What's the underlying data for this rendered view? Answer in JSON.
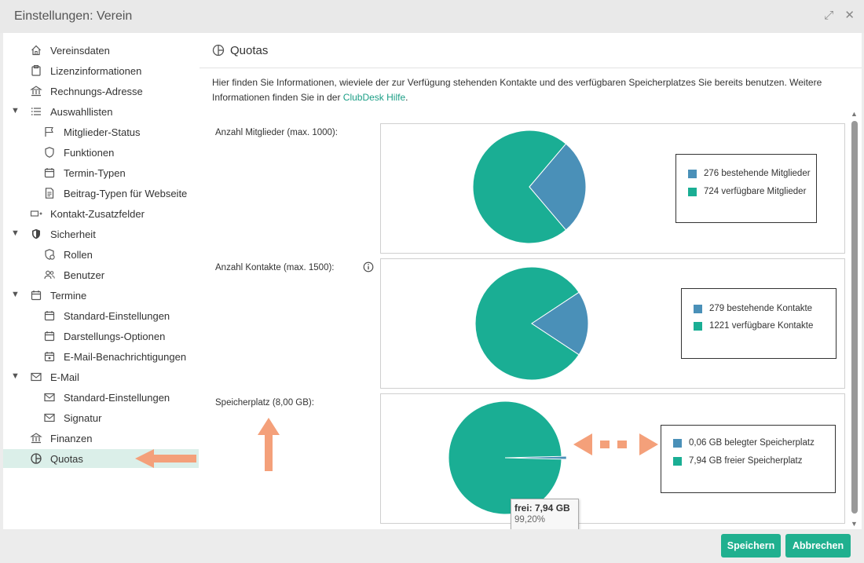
{
  "window": {
    "title": "Einstellungen: Verein",
    "expand_symbol": "⤢",
    "close_symbol": "✕"
  },
  "sidebar": {
    "items": [
      {
        "id": "vereinsdaten",
        "label": "Vereinsdaten",
        "icon": "home-icon",
        "level": 0
      },
      {
        "id": "lizenzinformationen",
        "label": "Lizenzinformationen",
        "icon": "clipboard-icon",
        "level": 0
      },
      {
        "id": "rechnungs-adresse",
        "label": "Rechnungs-Adresse",
        "icon": "bank-icon",
        "level": 0
      },
      {
        "id": "auswahllisten",
        "label": "Auswahllisten",
        "icon": "list-icon",
        "level": 0,
        "expanded": true
      },
      {
        "id": "mitglieder-status",
        "label": "Mitglieder-Status",
        "icon": "flag-icon",
        "level": 1
      },
      {
        "id": "funktionen",
        "label": "Funktionen",
        "icon": "shield-outline-icon",
        "level": 1
      },
      {
        "id": "termin-typen",
        "label": "Termin-Typen",
        "icon": "calendar-icon",
        "level": 1
      },
      {
        "id": "beitrag-typen",
        "label": "Beitrag-Typen für Webseite",
        "icon": "document-icon",
        "level": 1
      },
      {
        "id": "kontakt-zusatzfelder",
        "label": "Kontakt-Zusatzfelder",
        "icon": "field-add-icon",
        "level": 0
      },
      {
        "id": "sicherheit",
        "label": "Sicherheit",
        "icon": "shield-filled-icon",
        "level": 0,
        "expanded": true
      },
      {
        "id": "rollen",
        "label": "Rollen",
        "icon": "shield-gear-icon",
        "level": 1
      },
      {
        "id": "benutzer",
        "label": "Benutzer",
        "icon": "users-icon",
        "level": 1
      },
      {
        "id": "termine",
        "label": "Termine",
        "icon": "calendar-icon",
        "level": 0,
        "expanded": true
      },
      {
        "id": "termine-standard",
        "label": "Standard-Einstellungen",
        "icon": "calendar-icon",
        "level": 1
      },
      {
        "id": "darstellungs-optionen",
        "label": "Darstellungs-Optionen",
        "icon": "calendar-icon",
        "level": 1
      },
      {
        "id": "email-benachrichtigungen",
        "label": "E-Mail-Benachrichtigungen",
        "icon": "calendar-bell-icon",
        "level": 1
      },
      {
        "id": "email",
        "label": "E-Mail",
        "icon": "mail-icon",
        "level": 0,
        "expanded": true
      },
      {
        "id": "email-standard",
        "label": "Standard-Einstellungen",
        "icon": "mail-icon",
        "level": 1
      },
      {
        "id": "signatur",
        "label": "Signatur",
        "icon": "mail-icon",
        "level": 1
      },
      {
        "id": "finanzen",
        "label": "Finanzen",
        "icon": "bank-icon",
        "level": 0
      },
      {
        "id": "quotas",
        "label": "Quotas",
        "icon": "pie-icon",
        "level": 0,
        "selected": true
      }
    ]
  },
  "main": {
    "title": "Quotas",
    "intro_text": "Hier finden Sie Informationen, wieviele der zur Verfügung stehenden Kontakte und des verfügbaren Speicherplatzes Sie bereits benutzen. Weitere Informationen finden Sie in der ",
    "help_link": "ClubDesk Hilfe",
    "intro_end": "."
  },
  "colors": {
    "used": "#4a90b8",
    "free": "#1aae94",
    "accent": "#20b08f",
    "arrow": "#f4a07a"
  },
  "chart_data": [
    {
      "type": "pie",
      "title": "Anzahl Mitglieder (max. 1000):",
      "slices": [
        {
          "label": "276 bestehende Mitglieder",
          "value": 276
        },
        {
          "label": "724 verfügbare Mitglieder",
          "value": 724
        }
      ]
    },
    {
      "type": "pie",
      "title": "Anzahl Kontakte (max. 1500):",
      "slices": [
        {
          "label": "279 bestehende Kontakte",
          "value": 279
        },
        {
          "label": "1221 verfügbare Kontakte",
          "value": 1221
        }
      ]
    },
    {
      "type": "pie",
      "title": "Speicherplatz (8,00 GB):",
      "slices": [
        {
          "label": "0,06 GB belegter Speicherplatz",
          "value": 0.06
        },
        {
          "label": "7,94 GB freier Speicherplatz",
          "value": 7.94
        }
      ],
      "tooltip": {
        "title": "frei: 7,94 GB",
        "value": "99,20%"
      }
    }
  ],
  "buttons": {
    "save": "Speichern",
    "cancel": "Abbrechen"
  }
}
